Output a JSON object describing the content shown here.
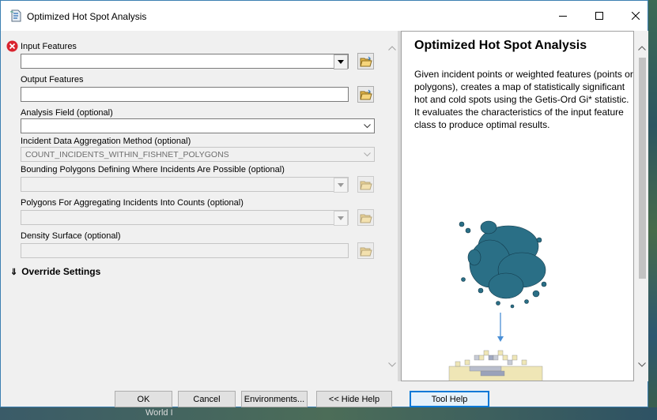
{
  "window": {
    "title": "Optimized Hot Spot Analysis"
  },
  "form": {
    "input_features_label": "Input Features",
    "output_features_label": "Output Features",
    "analysis_field_label": "Analysis Field (optional)",
    "aggregation_label": "Incident Data Aggregation Method (optional)",
    "aggregation_value": "COUNT_INCIDENTS_WITHIN_FISHNET_POLYGONS",
    "bounding_label": "Bounding Polygons Defining Where Incidents Are Possible (optional)",
    "aggregating_polygons_label": "Polygons For Aggregating Incidents Into Counts (optional)",
    "density_label": "Density Surface (optional)",
    "override_label": "Override Settings"
  },
  "help": {
    "title": "Optimized Hot Spot Analysis",
    "body": "Given incident points or weighted features (points or polygons), creates a map of statistically significant hot and cold spots using the Getis-Ord Gi* statistic. It evaluates the characteristics of the input feature class to produce optimal results."
  },
  "buttons": {
    "ok": "OK",
    "cancel": "Cancel",
    "environments": "Environments...",
    "hide_help": "<< Hide Help",
    "tool_help": "Tool Help"
  },
  "taskbar_fragment": "World I",
  "colors": {
    "accent": "#0078d7",
    "error": "#d9232e",
    "cluster": "#2a6f86"
  }
}
